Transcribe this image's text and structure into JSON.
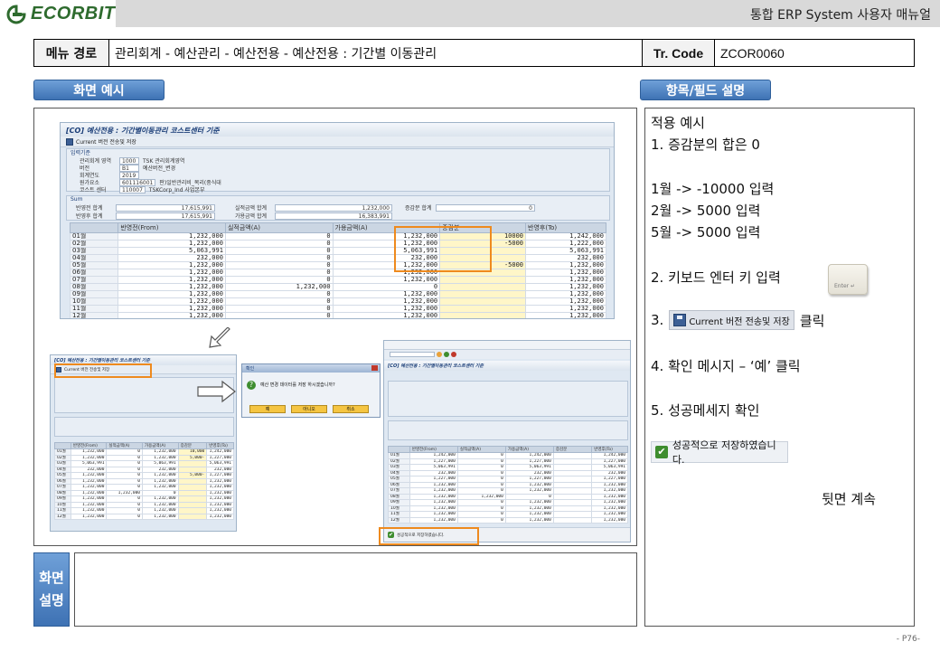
{
  "header": {
    "logo_text": "ECORBIT",
    "doc_title": "통합 ERP System 사용자 매뉴얼"
  },
  "info": {
    "menu_label": "메뉴 경로",
    "menu_path": "관리회계 - 예산관리 - 예산전용 - 예산전용 : 기간별 이동관리",
    "tr_label": "Tr. Code",
    "tr_code": "ZCOR0060"
  },
  "sections": {
    "screen_example": "화면 예시",
    "field_desc": "항목/필드 설명",
    "screen_note_1": "화면",
    "screen_note_2": "설명"
  },
  "description": {
    "l1": "적용 예시",
    "l2": "1.  증감분의 합은 0",
    "l3": "1월 ->  -10000 입력",
    "l4": "2월 -> 5000 입력",
    "l5": "5월 -> 5000 입력",
    "l6": "2. 키보드 엔터 키 입력",
    "l7_prefix": "3.",
    "l7_button": "Current 버전 전송및 저장",
    "l7_suffix": "클릭",
    "l8": "4. 확인 메시지 – ‘예’ 클릭",
    "l9": "5. 성공메세지 확인",
    "success_msg": "성공적으로 저장하였습니다.",
    "continue": "뒷면 계속",
    "keycap": "Enter ↵"
  },
  "page_number": "- P76-",
  "sap_main": {
    "title": "[CO] 예산전용 : 기간별이동관리 코스트센터 기준",
    "toolbar_btn": "Current 버전 전송및 저장",
    "group_title": "입력기준",
    "fields": [
      {
        "k": "관리회계 영역",
        "v": "1000",
        "t": "TSK 관리회계영역"
      },
      {
        "k": "버전",
        "v": "B1",
        "t": "예산버전_변경"
      },
      {
        "k": "회계연도",
        "v": "2019",
        "t": ""
      },
      {
        "k": "원가요소",
        "v": "601116001",
        "t": "판)일반관리비_복리(중식대"
      },
      {
        "k": "코스트 센터",
        "v": "110007",
        "t": "TSKCorp_Ind 사업본부"
      }
    ],
    "sum_title": "Sum",
    "sum_rows": [
      {
        "k1": "반영전 합계",
        "v1": "17,615,991",
        "k2": "실적금액 합계",
        "v2": "1,232,000",
        "k3": "증감분 합계",
        "v3": "0"
      },
      {
        "k1": "반영후 합계",
        "v1": "17,615,991",
        "k2": "가용금액 합계",
        "v2": "16,383,991",
        "k3": "",
        "v3": ""
      }
    ],
    "columns": [
      "",
      "반영전(From)",
      "실적금액(A)",
      "가용금액(A)",
      "증감분",
      "반영후(To)"
    ],
    "rows": [
      [
        "01월",
        "1,232,000",
        "0",
        "1,232,000",
        "10000",
        "1,242,000"
      ],
      [
        "02월",
        "1,232,000",
        "0",
        "1,232,000",
        "-5000",
        "1,222,000"
      ],
      [
        "03월",
        "5,063,991",
        "0",
        "5,063,991",
        "",
        "5,063,991"
      ],
      [
        "04월",
        "232,000",
        "0",
        "232,000",
        "",
        "232,000"
      ],
      [
        "05월",
        "1,232,000",
        "0",
        "1,232,000",
        "-5000",
        "1,232,000"
      ],
      [
        "06월",
        "1,232,000",
        "0",
        "1,232,000",
        "",
        "1,232,000"
      ],
      [
        "07월",
        "1,232,000",
        "0",
        "1,232,000",
        "",
        "1,232,000"
      ],
      [
        "08월",
        "1,232,000",
        "1,232,000",
        "0",
        "",
        "1,232,000"
      ],
      [
        "09월",
        "1,232,000",
        "0",
        "1,232,000",
        "",
        "1,232,000"
      ],
      [
        "10월",
        "1,232,000",
        "0",
        "1,232,000",
        "",
        "1,232,000"
      ],
      [
        "11월",
        "1,232,000",
        "0",
        "1,232,000",
        "",
        "1,232,000"
      ],
      [
        "12월",
        "1,232,000",
        "0",
        "1,232,000",
        "",
        "1,232,000"
      ]
    ]
  },
  "sap_dialog": {
    "title": "확인",
    "message": "예산 변경 데이터를 저장 하시겠습니까?",
    "btn_yes": "예",
    "btn_no": "아니오",
    "btn_cancel": "취소"
  },
  "sap_small_left": {
    "title": "[CO] 예산전용 : 기간별이동관리 코스트센터 기준",
    "toolbar_btn": "Current 버전 전송및 저장",
    "rows": [
      [
        "01월",
        "1,232,000",
        "0",
        "1,232,000",
        "10,000",
        "1,242,000"
      ],
      [
        "02월",
        "1,232,000",
        "0",
        "1,232,000",
        "5,000-",
        "1,227,000"
      ],
      [
        "03월",
        "5,063,991",
        "0",
        "5,063,991",
        "",
        "5,063,991"
      ],
      [
        "04월",
        "232,000",
        "0",
        "232,000",
        "",
        "232,000"
      ],
      [
        "05월",
        "1,232,000",
        "0",
        "1,232,000",
        "5,000-",
        "1,227,000"
      ],
      [
        "06월",
        "1,232,000",
        "0",
        "1,232,000",
        "",
        "1,232,000"
      ],
      [
        "07월",
        "1,232,000",
        "0",
        "1,232,000",
        "",
        "1,232,000"
      ],
      [
        "08월",
        "1,232,000",
        "1,232,000",
        "0",
        "",
        "1,232,000"
      ],
      [
        "09월",
        "1,232,000",
        "0",
        "1,232,000",
        "",
        "1,232,000"
      ],
      [
        "10월",
        "1,232,000",
        "0",
        "1,232,000",
        "",
        "1,232,000"
      ],
      [
        "11월",
        "1,232,000",
        "0",
        "1,232,000",
        "",
        "1,232,000"
      ],
      [
        "12월",
        "1,232,000",
        "0",
        "1,232,000",
        "",
        "1,232,000"
      ]
    ]
  },
  "sap_small_right": {
    "title": "[CO] 예산전용 : 기간별이동관리 코스트센터 기준",
    "status_msg": "성공적으로 저장하였습니다.",
    "rows": [
      [
        "01월",
        "1,242,000",
        "0",
        "1,242,000",
        "",
        "1,242,000"
      ],
      [
        "02월",
        "1,227,000",
        "0",
        "1,227,000",
        "",
        "1,227,000"
      ],
      [
        "03월",
        "5,063,991",
        "0",
        "5,063,991",
        "",
        "5,063,991"
      ],
      [
        "04월",
        "232,000",
        "0",
        "232,000",
        "",
        "232,000"
      ],
      [
        "05월",
        "1,227,000",
        "0",
        "1,227,000",
        "",
        "1,227,000"
      ],
      [
        "06월",
        "1,232,000",
        "0",
        "1,232,000",
        "",
        "1,232,000"
      ],
      [
        "07월",
        "1,232,000",
        "0",
        "1,232,000",
        "",
        "1,232,000"
      ],
      [
        "08월",
        "1,232,000",
        "1,232,000",
        "0",
        "",
        "1,232,000"
      ],
      [
        "09월",
        "1,232,000",
        "0",
        "1,232,000",
        "",
        "1,232,000"
      ],
      [
        "10월",
        "1,232,000",
        "0",
        "1,232,000",
        "",
        "1,232,000"
      ],
      [
        "11월",
        "1,232,000",
        "0",
        "1,232,000",
        "",
        "1,232,000"
      ],
      [
        "12월",
        "1,232,000",
        "0",
        "1,232,000",
        "",
        "1,232,000"
      ]
    ]
  }
}
